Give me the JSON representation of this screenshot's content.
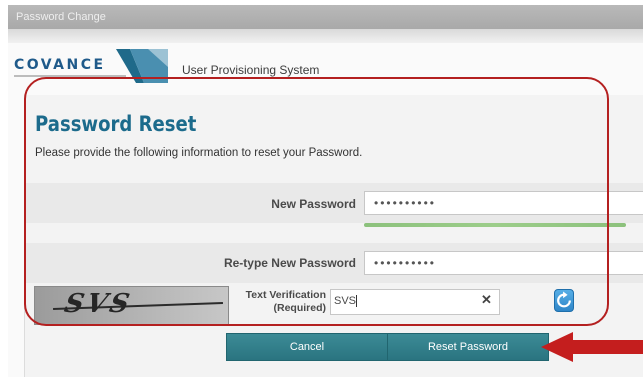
{
  "window": {
    "title": "Password Change"
  },
  "header": {
    "logo_text": "COVANCE",
    "system_name": "User Provisioning System"
  },
  "form": {
    "heading": "Password Reset",
    "instructions": "Please provide the following information to reset your Password.",
    "new_password": {
      "label": "New Password",
      "value": "••••••••••"
    },
    "retype_password": {
      "label": "Re-type New Password",
      "value": "••••••••••"
    },
    "text_verification": {
      "label_line1": "Text Verification",
      "label_line2": "(Required)",
      "value": "SVS"
    },
    "captcha_text": "SVS"
  },
  "icons": {
    "clear": "close-icon",
    "refresh": "refresh-icon",
    "arrow": "arrow-left-icon"
  },
  "buttons": {
    "cancel": "Cancel",
    "reset": "Reset Password"
  },
  "colors": {
    "accent": "#2a7480",
    "heading": "#1c6b8c",
    "highlight": "#b42020",
    "strength": "#8cc17c"
  }
}
